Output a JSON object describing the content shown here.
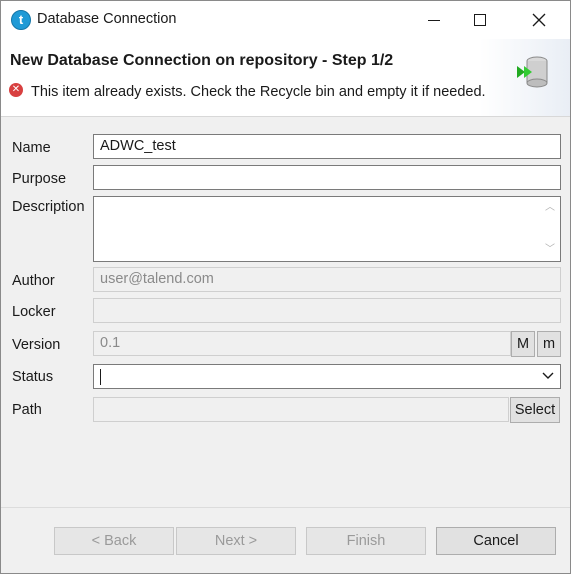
{
  "window": {
    "title": "Database Connection",
    "icon_letter": "t"
  },
  "header": {
    "title": "New Database Connection on repository - Step 1/2",
    "error_message": "This item already exists. Check the Recycle bin and empty it if needed."
  },
  "form": {
    "name": {
      "label": "Name",
      "value": "ADWC_test"
    },
    "purpose": {
      "label": "Purpose",
      "value": ""
    },
    "description": {
      "label": "Description",
      "value": ""
    },
    "author": {
      "label": "Author",
      "value": "user@talend.com"
    },
    "locker": {
      "label": "Locker",
      "value": ""
    },
    "version": {
      "label": "Version",
      "value": "0.1",
      "major_label": "M",
      "minor_label": "m"
    },
    "status": {
      "label": "Status",
      "value": ""
    },
    "path": {
      "label": "Path",
      "value": "",
      "select_label": "Select"
    }
  },
  "footer": {
    "back_label": "< Back",
    "next_label": "Next >",
    "finish_label": "Finish",
    "cancel_label": "Cancel"
  },
  "colors": {
    "error": "#d84040",
    "app_icon": "#1f9ad6",
    "wizard_arrow": "#22aa22"
  }
}
